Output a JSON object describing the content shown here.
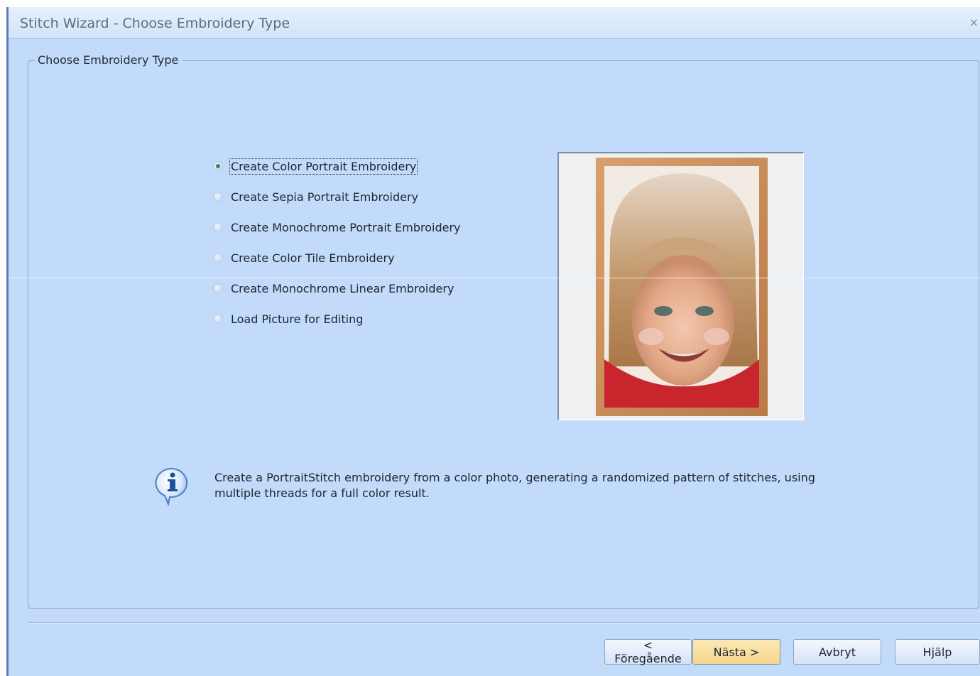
{
  "window": {
    "title": "Stitch Wizard - Choose Embroidery Type",
    "close_glyph": "×"
  },
  "group": {
    "legend": "Choose Embroidery Type"
  },
  "options": [
    {
      "label": "Create Color Portrait Embroidery",
      "checked": true
    },
    {
      "label": "Create Sepia Portrait Embroidery",
      "checked": false
    },
    {
      "label": "Create Monochrome Portrait Embroidery",
      "checked": false
    },
    {
      "label": "Create Color Tile Embroidery",
      "checked": false
    },
    {
      "label": "Create Monochrome Linear Embroidery",
      "checked": false
    },
    {
      "label": "Load Picture for Editing",
      "checked": false
    }
  ],
  "info": {
    "icon": "info-icon",
    "text": "Create a PortraitStitch embroidery from a color photo, generating a randomized pattern of stitches, using multiple threads for a full color result."
  },
  "buttons": {
    "back": "< Föregående",
    "next": "Nästa >",
    "cancel": "Avbryt",
    "help": "Hjälp"
  },
  "colors": {
    "background": "#c2dbfb",
    "default_button": "#f6d58a",
    "frame_wood": "#c98a55"
  }
}
